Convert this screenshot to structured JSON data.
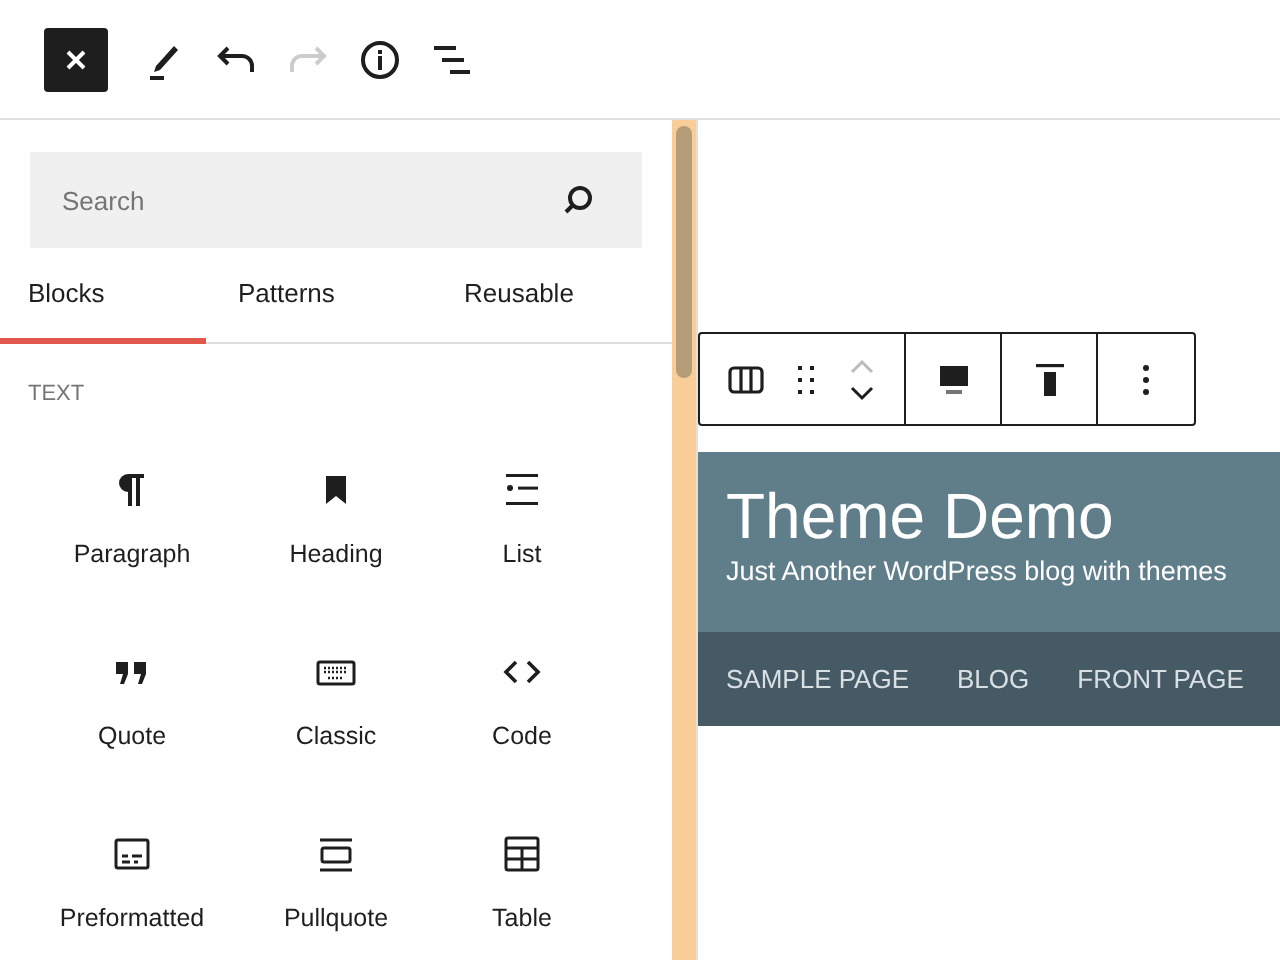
{
  "top_toolbar": [
    {
      "kind": "close",
      "disabled": false
    },
    {
      "kind": "edit",
      "disabled": false
    },
    {
      "kind": "undo",
      "disabled": false
    },
    {
      "kind": "redo",
      "disabled": true
    },
    {
      "kind": "info",
      "disabled": false
    },
    {
      "kind": "outline",
      "disabled": false
    }
  ],
  "search": {
    "placeholder": "Search"
  },
  "tabs": [
    {
      "label": "Blocks",
      "selected": true
    },
    {
      "label": "Patterns",
      "selected": false
    },
    {
      "label": "Reusable",
      "selected": false
    }
  ],
  "category": "TEXT",
  "blocks": [
    {
      "name": "Paragraph",
      "kind": "paragraph"
    },
    {
      "name": "Heading",
      "kind": "heading"
    },
    {
      "name": "List",
      "kind": "list"
    },
    {
      "name": "Quote",
      "kind": "quote"
    },
    {
      "name": "Classic",
      "kind": "classic"
    },
    {
      "name": "Code",
      "kind": "code"
    },
    {
      "name": "Preformatted",
      "kind": "preformatted"
    },
    {
      "name": "Pullquote",
      "kind": "pullquote"
    },
    {
      "name": "Table",
      "kind": "table"
    }
  ],
  "canvas": {
    "site_title": "Theme Demo",
    "tagline": "Just Another WordPress blog with themes",
    "nav": [
      "SAMPLE PAGE",
      "BLOG",
      "FRONT PAGE"
    ]
  }
}
